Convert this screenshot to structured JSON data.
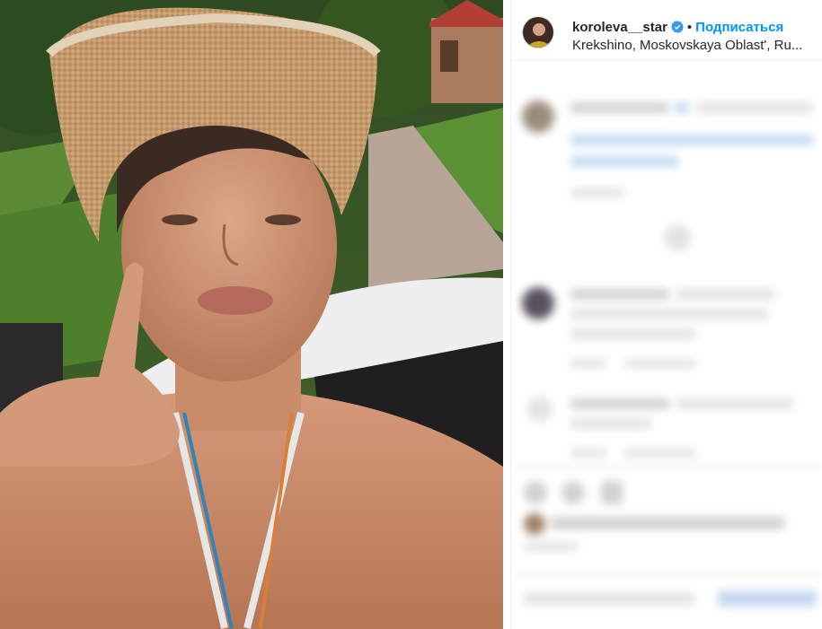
{
  "post": {
    "username": "koroleva__star",
    "verified": true,
    "separator": "•",
    "follow_label": "Подписаться",
    "location": "Krekshino, Moskovskaya Oblast', Ru..."
  },
  "colors": {
    "link": "#0095f6",
    "text": "#262626",
    "verified_badge": "#3897f0",
    "border": "#efefef"
  },
  "icons": [
    "verified-badge-icon",
    "more-options-icon"
  ]
}
